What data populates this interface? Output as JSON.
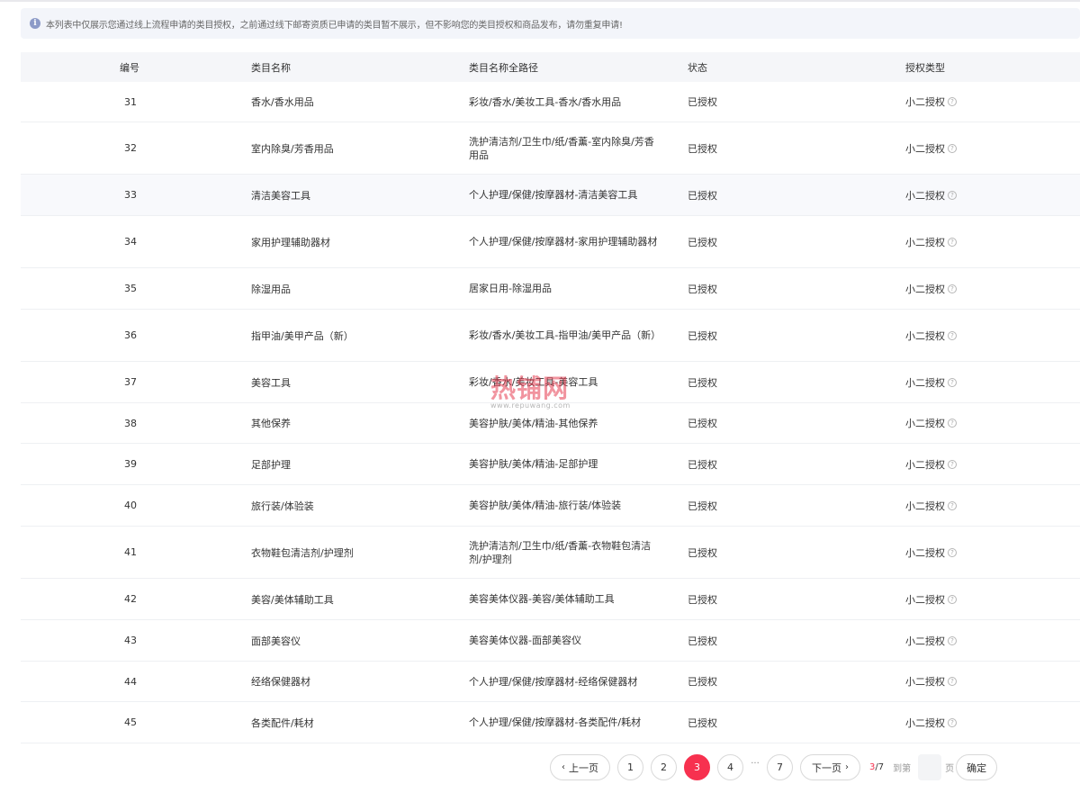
{
  "notice": {
    "text": "本列表中仅展示您通过线上流程申请的类目授权，之前通过线下邮寄资质已申请的类目暂不展示，但不影响您的类目授权和商品发布，请勿重复申请!"
  },
  "table": {
    "headers": {
      "id": "编号",
      "name": "类目名称",
      "path": "类目名称全路径",
      "status": "状态",
      "auth_type": "授权类型"
    },
    "rows": [
      {
        "id": "31",
        "name": "香水/香水用品",
        "path": "彩妆/香水/美妆工具-香水/香水用品",
        "status": "已授权",
        "auth_type": "小二授权"
      },
      {
        "id": "32",
        "name": "室内除臭/芳香用品",
        "path": "洗护清洁剂/卫生巾/纸/香薰-室内除臭/芳香用品",
        "status": "已授权",
        "auth_type": "小二授权"
      },
      {
        "id": "33",
        "name": "清洁美容工具",
        "path": "个人护理/保健/按摩器材-清洁美容工具",
        "status": "已授权",
        "auth_type": "小二授权"
      },
      {
        "id": "34",
        "name": "家用护理辅助器材",
        "path": "个人护理/保健/按摩器材-家用护理辅助器材",
        "status": "已授权",
        "auth_type": "小二授权"
      },
      {
        "id": "35",
        "name": "除湿用品",
        "path": "居家日用-除湿用品",
        "status": "已授权",
        "auth_type": "小二授权"
      },
      {
        "id": "36",
        "name": "指甲油/美甲产品（新）",
        "path": "彩妆/香水/美妆工具-指甲油/美甲产品（新）",
        "status": "已授权",
        "auth_type": "小二授权"
      },
      {
        "id": "37",
        "name": "美容工具",
        "path": "彩妆/香水/美妆工具-美容工具",
        "status": "已授权",
        "auth_type": "小二授权"
      },
      {
        "id": "38",
        "name": "其他保养",
        "path": "美容护肤/美体/精油-其他保养",
        "status": "已授权",
        "auth_type": "小二授权"
      },
      {
        "id": "39",
        "name": "足部护理",
        "path": "美容护肤/美体/精油-足部护理",
        "status": "已授权",
        "auth_type": "小二授权"
      },
      {
        "id": "40",
        "name": "旅行装/体验装",
        "path": "美容护肤/美体/精油-旅行装/体验装",
        "status": "已授权",
        "auth_type": "小二授权"
      },
      {
        "id": "41",
        "name": "衣物鞋包清洁剂/护理剂",
        "path": "洗护清洁剂/卫生巾/纸/香薰-衣物鞋包清洁剂/护理剂",
        "status": "已授权",
        "auth_type": "小二授权"
      },
      {
        "id": "42",
        "name": "美容/美体辅助工具",
        "path": "美容美体仪器-美容/美体辅助工具",
        "status": "已授权",
        "auth_type": "小二授权"
      },
      {
        "id": "43",
        "name": "面部美容仪",
        "path": "美容美体仪器-面部美容仪",
        "status": "已授权",
        "auth_type": "小二授权"
      },
      {
        "id": "44",
        "name": "经络保健器材",
        "path": "个人护理/保健/按摩器材-经络保健器材",
        "status": "已授权",
        "auth_type": "小二授权"
      },
      {
        "id": "45",
        "name": "各类配件/耗材",
        "path": "个人护理/保健/按摩器材-各类配件/耗材",
        "status": "已授权",
        "auth_type": "小二授权"
      }
    ]
  },
  "watermark": {
    "main": "热铺网",
    "sub": "www.repuwang.com"
  },
  "pagination": {
    "prev_label": "上一页",
    "next_label": "下一页",
    "pages": [
      "1",
      "2",
      "3",
      "4"
    ],
    "last_page": "7",
    "ellipsis": "···",
    "current_page": "3",
    "current_text": "3",
    "total_text": "/7",
    "goto_label": "到第",
    "page_suffix": "页",
    "confirm_label": "确定",
    "accent_color": "#f7314f"
  }
}
